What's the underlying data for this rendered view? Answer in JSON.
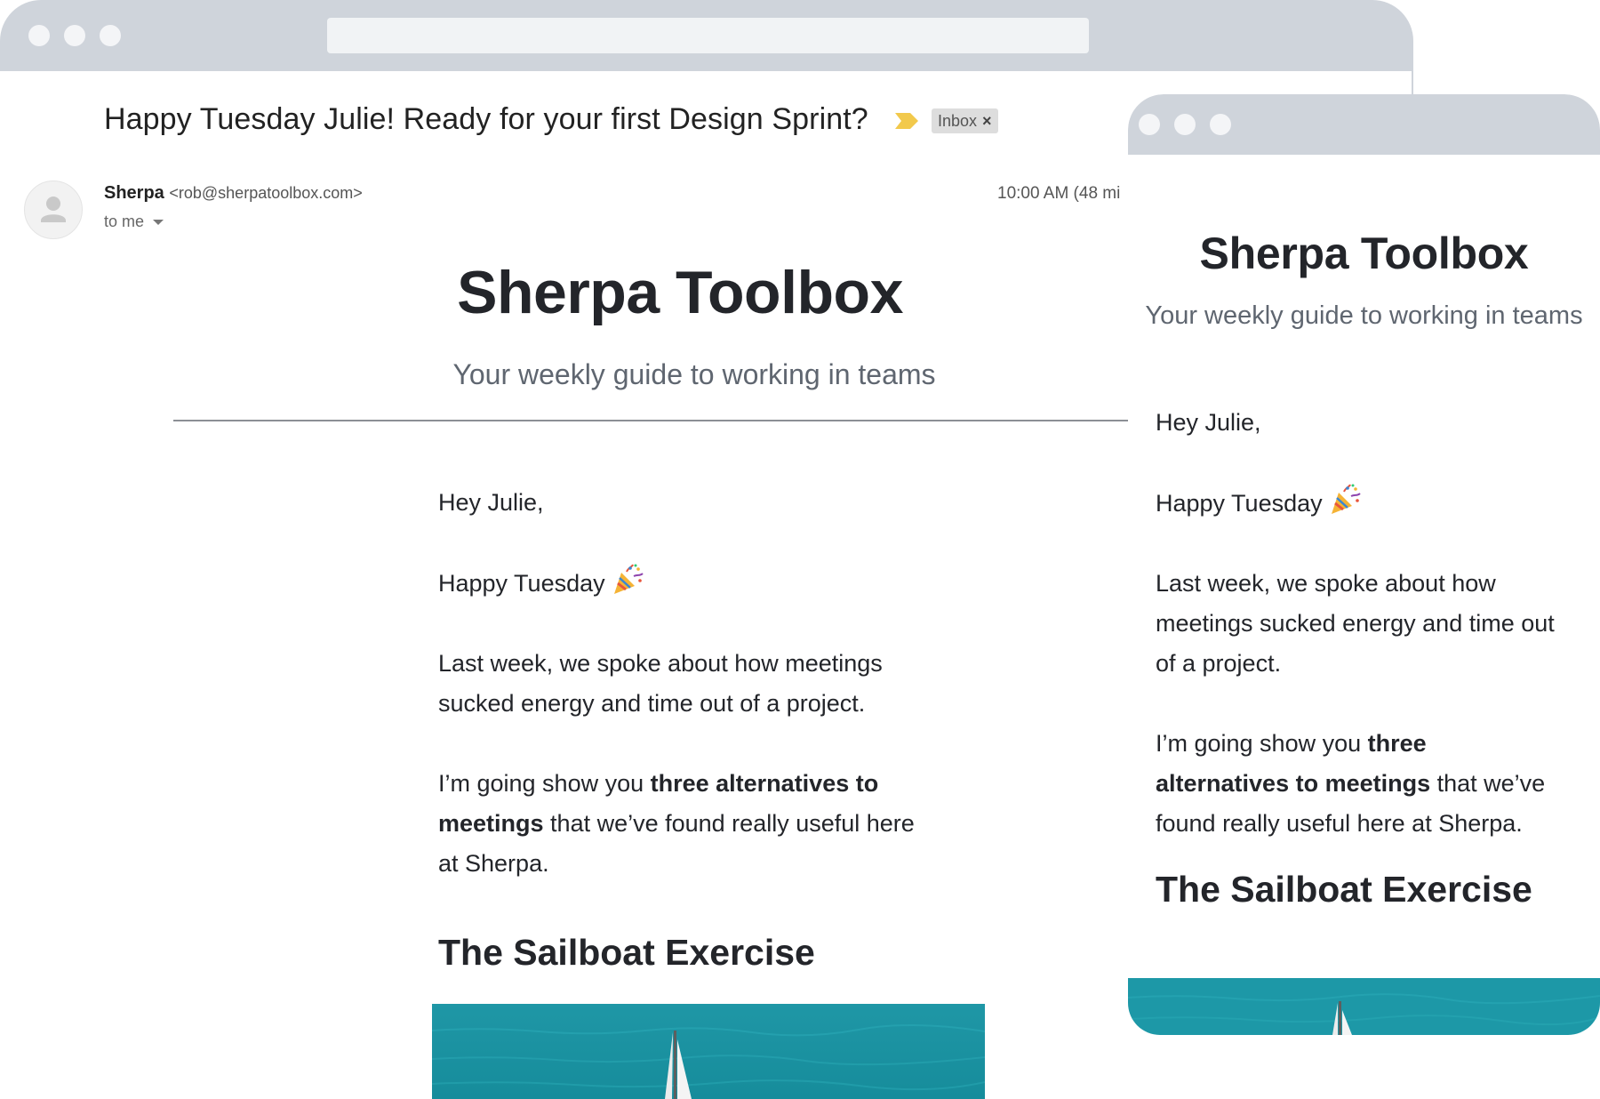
{
  "desktop": {
    "subject": "Happy Tuesday Julie! Ready for your first Design Sprint?",
    "inbox_label": "Inbox",
    "inbox_remove": "×",
    "sender_name": "Sherpa",
    "sender_email": "<rob@sherpatoolbox.com>",
    "to_label": "to me",
    "timestamp": "10:00 AM (48 mi",
    "brand_title": "Sherpa Toolbox",
    "brand_tagline": "Your weekly guide to working in teams",
    "greeting": "Hey Julie,",
    "happy": "Happy Tuesday",
    "p1": "Last week, we spoke about how meetings sucked energy and time out of a project.",
    "p2_pre": "I’m going show you ",
    "p2_bold": "three alternatives to meetings",
    "p2_post": " that we’ve found really useful here at Sherpa.",
    "heading": "The Sailboat Exercise"
  },
  "mobile": {
    "brand_title": "Sherpa Toolbox",
    "brand_tagline": "Your weekly guide to working in teams",
    "greeting": "Hey Julie,",
    "happy": "Happy Tuesday",
    "p1": "Last week, we spoke about how meetings sucked energy and time out of a project.",
    "p2_pre": "I’m going show you ",
    "p2_bold": "three alternatives to meetings",
    "p2_post": " that we’ve found really useful here at Sherpa.",
    "heading": "The Sailboat Exercise"
  },
  "colors": {
    "window_bar": "#cfd4db",
    "text": "#23252a",
    "muted_text": "#5f6670",
    "importance_marker": "#f2c94c",
    "sea": "#1e9aa8"
  },
  "icons": {
    "importance": "importance-marker-icon",
    "avatar": "person-icon",
    "party": "party-popper-icon",
    "dropdown": "chevron-down-icon"
  }
}
